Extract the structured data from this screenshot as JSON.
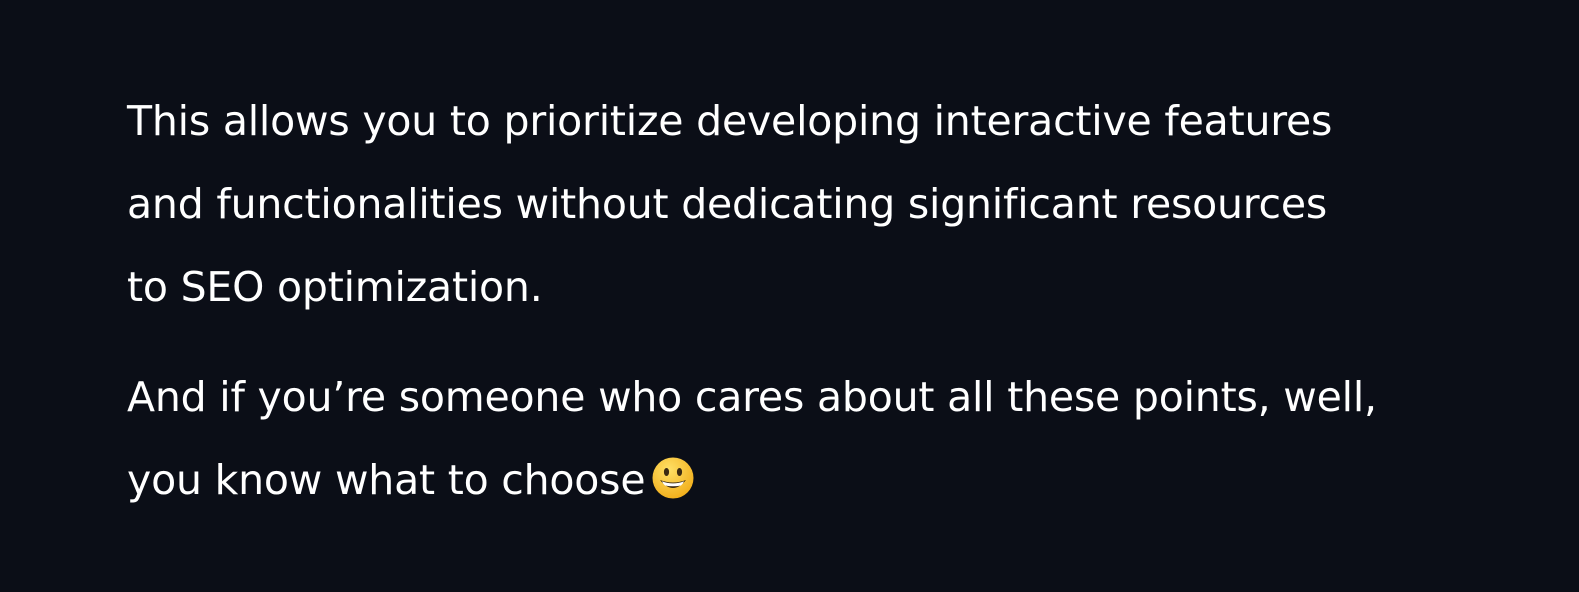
{
  "article": {
    "paragraphs": [
      {
        "lines": [
          "This allows you to prioritize developing interactive features",
          "and functionalities without dedicating significant resources",
          "to SEO optimization."
        ]
      },
      {
        "lines": [
          "And if you’re someone who cares about all these points, well,",
          "you know what to choose"
        ],
        "trailing_icon": "smiling-face-emoji"
      }
    ]
  },
  "colors": {
    "background": "#0b0e17",
    "text": "#ffffff",
    "emoji_face": "#f8c22d",
    "emoji_features": "#3b2a12"
  }
}
